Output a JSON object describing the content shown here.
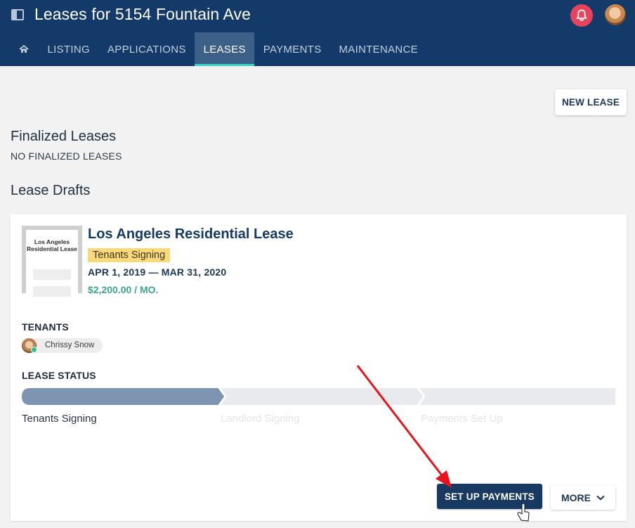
{
  "header": {
    "title": "Leases for 5154 Fountain Ave",
    "nav": {
      "listing": "LISTING",
      "applications": "APPLICATIONS",
      "leases": "LEASES",
      "payments": "PAYMENTS",
      "maintenance": "MAINTENANCE"
    },
    "active_tab": "LEASES"
  },
  "main": {
    "new_lease_label": "NEW LEASE",
    "finalized_title": "Finalized Leases",
    "finalized_empty": "NO FINALIZED LEASES",
    "drafts_title": "Lease Drafts"
  },
  "lease": {
    "thumbnail_text": "Los Angeles Residential Lease",
    "title": "Los Angeles Residential Lease",
    "status_badge": "Tenants Signing",
    "dates": "APR 1, 2019 — MAR 31, 2020",
    "rent": "$2,200.00 / MO.",
    "tenants_label": "TENANTS",
    "tenant_name": "Chrissy Snow",
    "status_label": "LEASE STATUS",
    "steps": [
      "Tenants Signing",
      "Landlord Signing",
      "Payments Set Up"
    ],
    "completed_steps": 1,
    "setup_payments_label": "SET UP PAYMENTS",
    "more_label": "MORE"
  },
  "colors": {
    "header_bg": "#133a68",
    "active_tab_underline": "#39d7c2",
    "badge": "#f9d978",
    "rent": "#3ea58a",
    "primary_button": "#173962",
    "annotation_arrow": "#e8131b"
  }
}
